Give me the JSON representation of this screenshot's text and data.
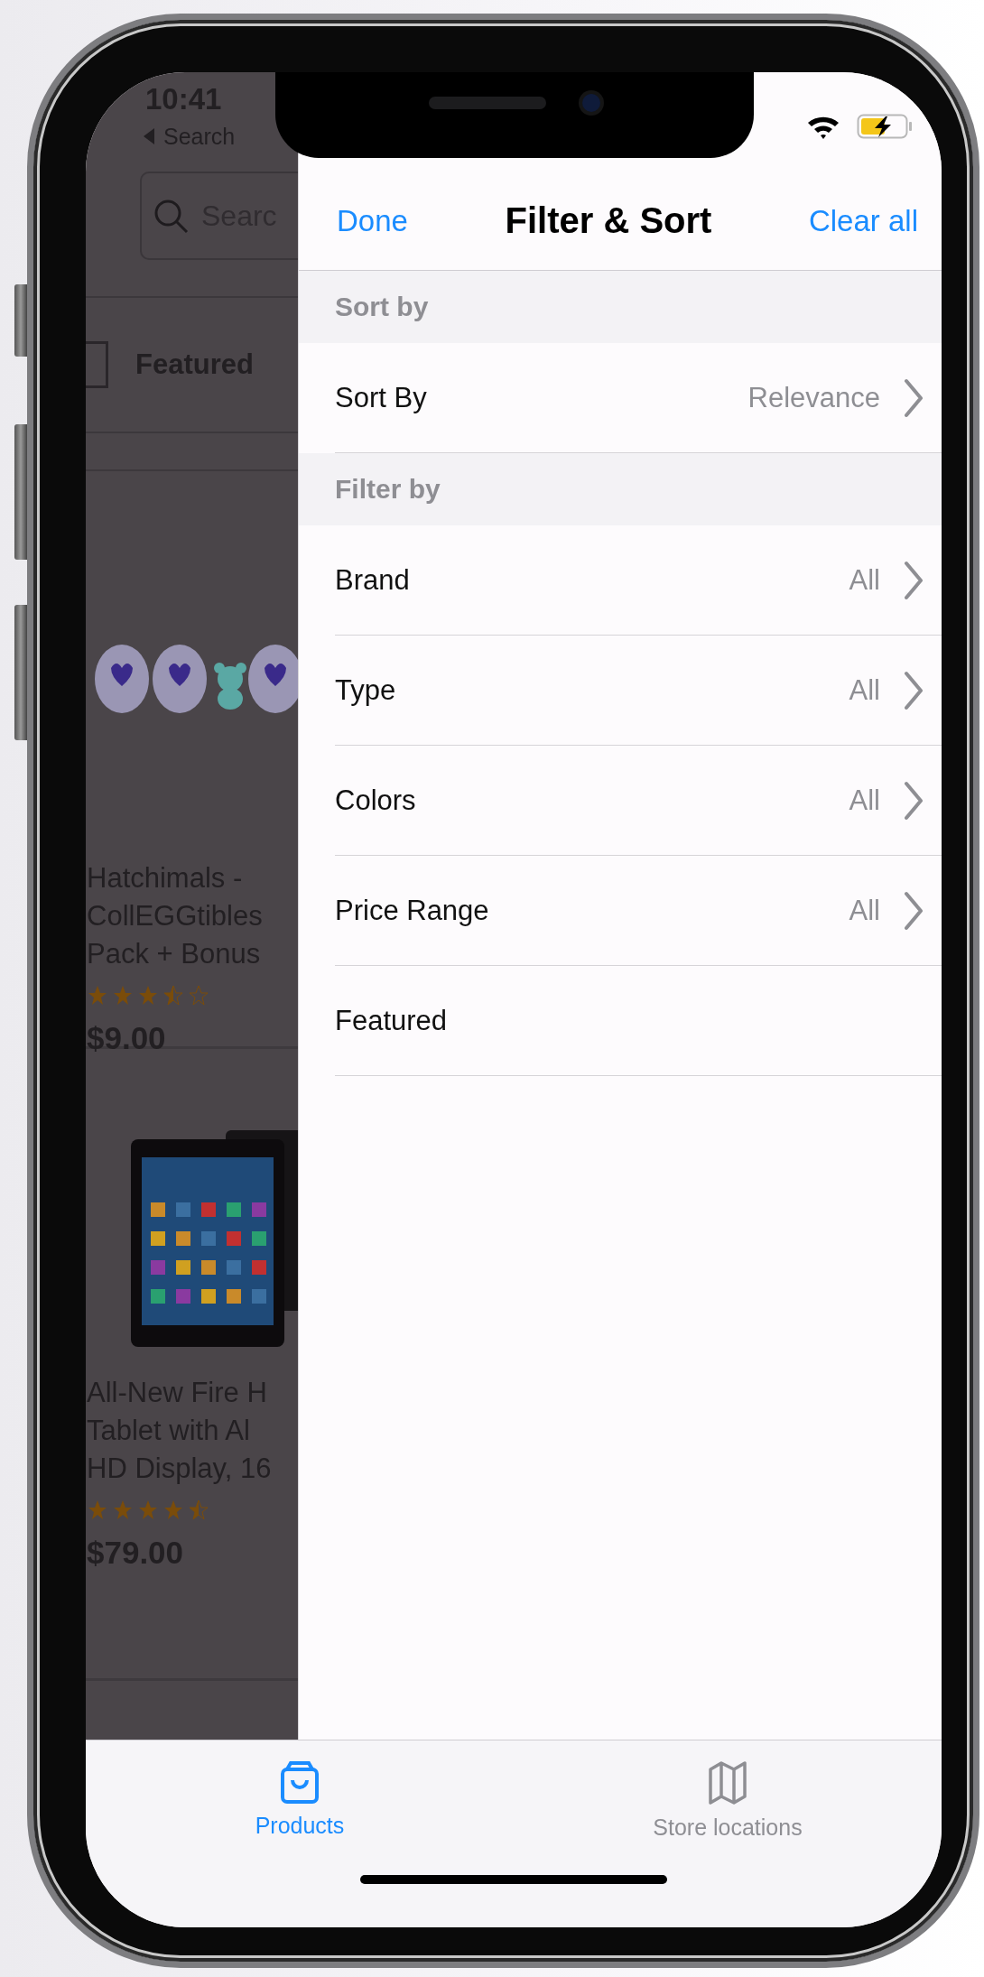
{
  "status_bar": {
    "time": "10:41",
    "back_label": "Search"
  },
  "background_screen": {
    "search": {
      "placeholder": "Searc"
    },
    "sort_checked": false,
    "sort_label": "Featured",
    "products": [
      {
        "title_lines": [
          "Hatchimals -",
          "CollEGGtibles",
          "Pack + Bonus"
        ],
        "stars": 3.5,
        "price": "$9.00"
      },
      {
        "title_lines": [
          "All-New Fire H",
          "Tablet with Al",
          "HD Display, 16"
        ],
        "stars": 4.5,
        "price": "$79.00"
      }
    ]
  },
  "filter_panel": {
    "done": "Done",
    "title": "Filter & Sort",
    "clear": "Clear all",
    "sections": [
      {
        "header": "Sort by",
        "rows": [
          {
            "label": "Sort By",
            "value": "Relevance"
          }
        ]
      },
      {
        "header": "Filter by",
        "rows": [
          {
            "label": "Brand",
            "value": "All"
          },
          {
            "label": "Type",
            "value": "All"
          },
          {
            "label": "Colors",
            "value": "All"
          },
          {
            "label": "Price Range",
            "value": "All"
          },
          {
            "label": "Featured"
          }
        ]
      }
    ]
  },
  "tab_bar": {
    "items": [
      {
        "label": "Products",
        "selected": true
      },
      {
        "label": "Store locations",
        "selected": false
      }
    ]
  }
}
